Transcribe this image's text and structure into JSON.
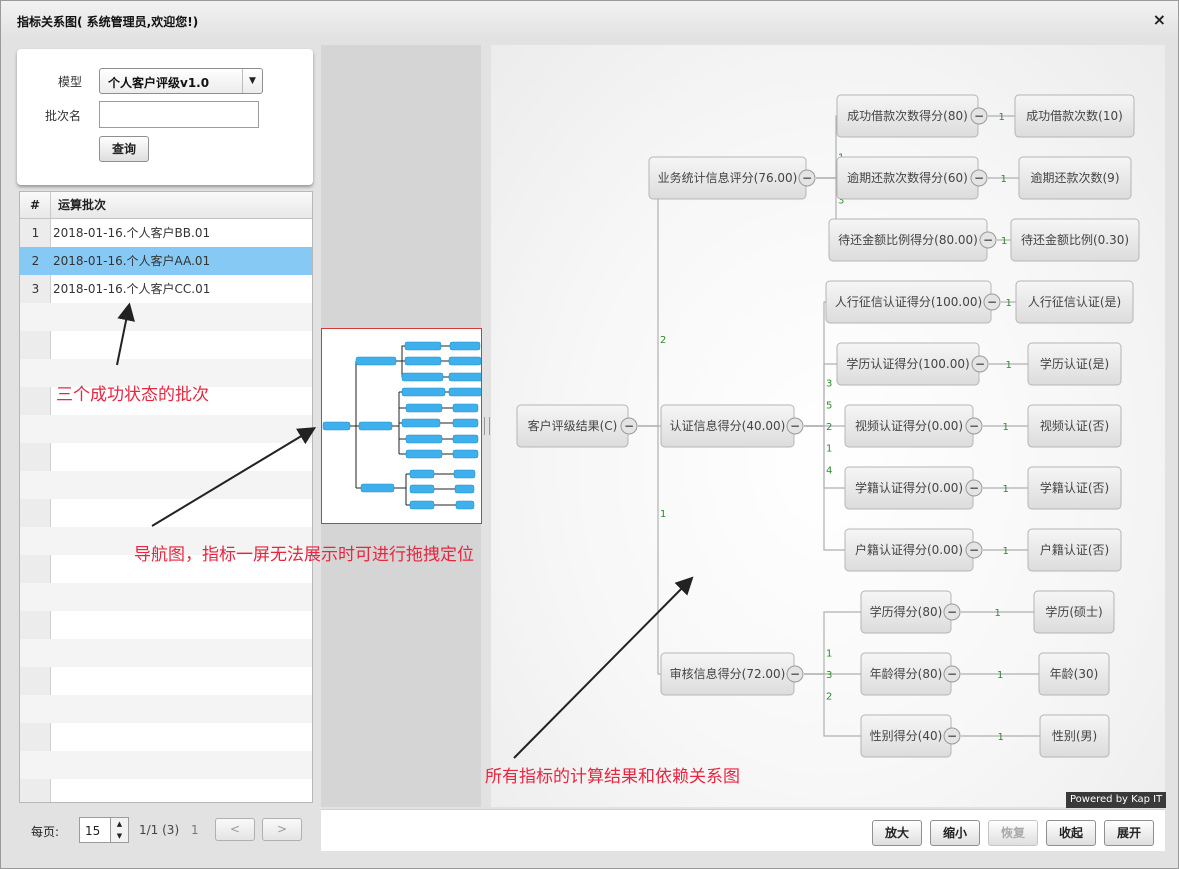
{
  "window": {
    "title": "指标关系图( 系统管理员,欢迎您!)",
    "close": "×"
  },
  "query": {
    "model_label": "模型",
    "model_value": "个人客户评级v1.0",
    "batch_label": "批次名",
    "batch_value": "",
    "search_button": "查询"
  },
  "grid": {
    "col_num": "#",
    "col_batch": "运算批次",
    "rows": [
      {
        "num": "1",
        "batch": "2018-01-16.个人客户BB.01"
      },
      {
        "num": "2",
        "batch": "2018-01-16.个人客户AA.01"
      },
      {
        "num": "3",
        "batch": "2018-01-16.个人客户CC.01"
      }
    ],
    "selected_row": 2
  },
  "pager": {
    "per_page_label": "每页:",
    "per_page": "15",
    "page_info": "1/1 (3)",
    "current_page": "1",
    "prev": "<",
    "next": ">"
  },
  "graph": {
    "root": {
      "label": "客户评级结果(C)"
    },
    "nodes": [
      {
        "label": "业务统计信息评分(76.00)"
      },
      {
        "label": "认证信息得分(40.00)"
      },
      {
        "label": "审核信息得分(72.00)"
      },
      {
        "label": "成功借款次数得分(80)"
      },
      {
        "label": "逾期还款次数得分(60)"
      },
      {
        "label": "待还金额比例得分(80.00)"
      },
      {
        "label": "人行征信认证得分(100.00)"
      },
      {
        "label": "学历认证得分(100.00)"
      },
      {
        "label": "视频认证得分(0.00)"
      },
      {
        "label": "学籍认证得分(0.00)"
      },
      {
        "label": "户籍认证得分(0.00)"
      },
      {
        "label": "学历得分(80)"
      },
      {
        "label": "年龄得分(80)"
      },
      {
        "label": "性别得分(40)"
      },
      {
        "label": "成功借款次数(10)"
      },
      {
        "label": "逾期还款次数(9)"
      },
      {
        "label": "待还金额比例(0.30)"
      },
      {
        "label": "人行征信认证(是)"
      },
      {
        "label": "学历认证(是)"
      },
      {
        "label": "视频认证(否)"
      },
      {
        "label": "学籍认证(否)"
      },
      {
        "label": "户籍认证(否)"
      },
      {
        "label": "学历(硕士)"
      },
      {
        "label": "年龄(30)"
      },
      {
        "label": "性别(男)"
      }
    ],
    "edge_labels": [
      "2",
      "3",
      "1",
      "1",
      "2",
      "3",
      "3",
      "5",
      "2",
      "1",
      "4",
      "1",
      "3",
      "2",
      "1",
      "1",
      "1",
      "1",
      "1",
      "1",
      "1",
      "1",
      "1",
      "1",
      "1"
    ],
    "collapse_glyph": "−",
    "powered_by": "Powered by Kap IT"
  },
  "toolbar": {
    "zoom_in": "放大",
    "zoom_out": "缩小",
    "restore": "恢复",
    "collapse": "收起",
    "expand": "展开"
  },
  "annotations": {
    "batches": "三个成功状态的批次",
    "navigator": "导航图，指标一屏无法展示时可进行拖拽定位",
    "graph": "所有指标的计算结果和依赖关系图"
  },
  "colors": {
    "selected_row": "#86c9f5",
    "annotation": "#e8263f",
    "edge_label": "#2e8b2e",
    "nav_bar": "#3fb0ec"
  }
}
